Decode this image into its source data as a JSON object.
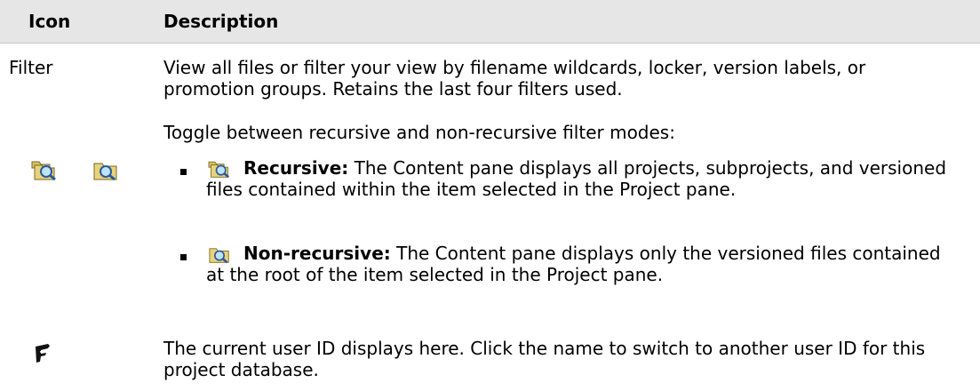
{
  "header": {
    "icon_col": "Icon",
    "desc_col": "Description"
  },
  "rows": [
    {
      "label": "Filter",
      "text": "View all files or filter your view by filename wildcards, locker, version labels, or promotion groups. Retains the last four filters used."
    },
    {
      "icons": [
        "recursive-filter-icon",
        "non-recursive-filter-icon"
      ],
      "text": "Toggle between recursive and non-recursive filter modes:",
      "bullets": [
        {
          "icon": "recursive-filter-icon",
          "term": "Recursive:",
          "text": "The Content pane displays all projects, subprojects, and versioned files contained within the item selected in the Project pane."
        },
        {
          "icon": "non-recursive-filter-icon",
          "term": "Non-recursive:",
          "text": "The Content pane displays only the versioned files contained at the root of the item selected in the Project pane."
        }
      ]
    },
    {
      "icons": [
        "user-id-icon"
      ],
      "text": "The current user ID displays here. Click the name to switch to another user ID for this project database."
    }
  ]
}
